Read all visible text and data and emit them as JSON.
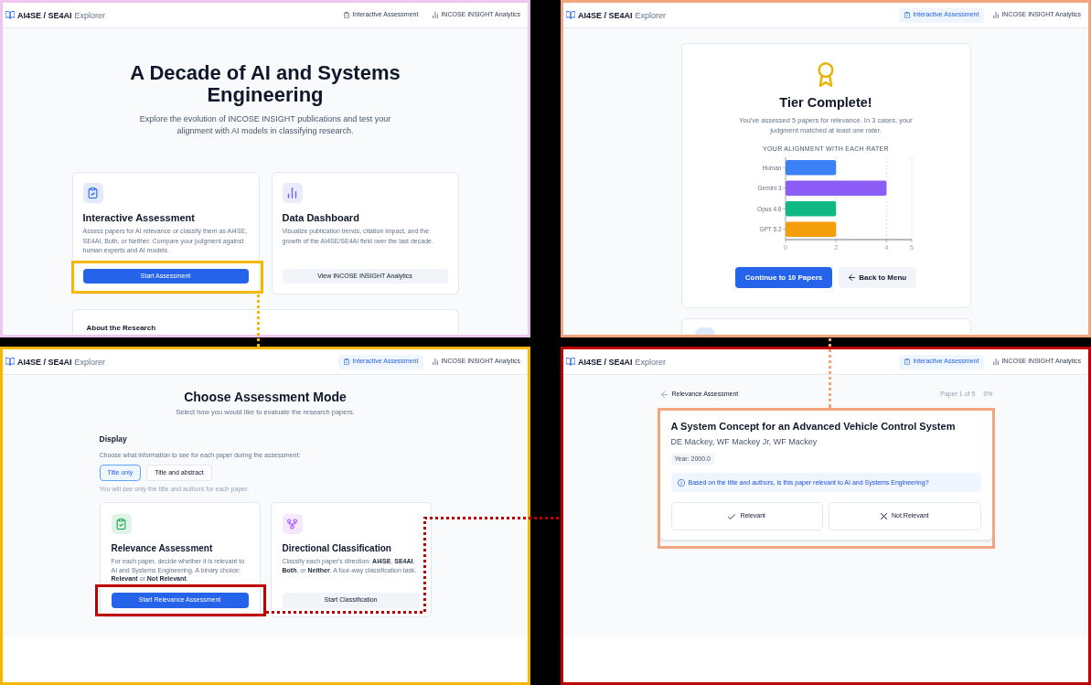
{
  "panels": [
    {
      "kind": "home",
      "color": "#efc6ef",
      "header": {
        "brand": "AI4SE / SE4AI",
        "brand_suffix": "Explorer",
        "nav": [
          {
            "label": "Interactive Assessment",
            "selected": false
          },
          {
            "label": "INCOSE INSIGHT Analytics",
            "selected": false
          }
        ]
      },
      "title": "A Decade of AI and Systems Engineering",
      "subtitle": "Explore the evolution of INCOSE INSIGHT publications and test your alignment with AI models in classifying research.",
      "cards": [
        {
          "title": "Interactive Assessment",
          "color": "#2563eb",
          "description": "Assess papers for AI relevance or classify them as AI4SE, SE4AI, Both, or Neither. Compare your judgment against human experts and AI models.",
          "button": {
            "label": "Start Assessment",
            "kind": "primary",
            "highlight": {
              "color": "#f5b800"
            }
          }
        },
        {
          "title": "Data Dashboard",
          "color": "#6366f1",
          "description": "Visualize publication trends, citation impact, and the growth of the AI4SE/SE4AI field over the last decade.",
          "button": {
            "label": "View INCOSE INSIGHT Analytics",
            "kind": "secondary"
          }
        }
      ],
      "section_title": "About the Research"
    },
    {
      "kind": "results",
      "color": "#f3a67e",
      "header": {
        "brand": "AI4SE / SE4AI",
        "brand_suffix": "Explorer",
        "nav": [
          {
            "label": "Interactive Assessment",
            "selected": true
          },
          {
            "label": "INCOSE INSIGHT Analytics",
            "selected": false
          }
        ]
      },
      "title": "Tier Complete!",
      "message": "You've assessed 5 papers for relevance. In 3 cases, your judgment matched at least one rater.",
      "chart_data": {
        "type": "bar",
        "title": "YOUR ALIGNMENT WITH EACH RATER",
        "orientation": "horizontal",
        "categories": [
          "Human",
          "Gemini 3",
          "Opus 4.6",
          "GPT 5.2"
        ],
        "series": [
          {
            "color": "#3b82f6",
            "values": [
              2,
              null,
              null,
              null
            ]
          },
          {
            "color": "#8b5cf6",
            "values": [
              null,
              4,
              null,
              null
            ]
          },
          {
            "color": "#10b981",
            "values": [
              null,
              null,
              2,
              null
            ]
          },
          {
            "color": "#f59e0b",
            "values": [
              null,
              null,
              null,
              2
            ]
          }
        ],
        "xlim": [
          0,
          5
        ],
        "xticks": [
          0,
          2,
          4,
          5
        ]
      },
      "buttons": [
        {
          "label": "Continue to 10 Papers",
          "kind": "primary"
        },
        {
          "label": "Back to Menu",
          "kind": "secondary"
        }
      ]
    },
    {
      "kind": "mode",
      "color": "#f5b800",
      "header": {
        "brand": "AI4SE / SE4AI",
        "brand_suffix": "Explorer",
        "nav": [
          {
            "label": "Interactive Assessment",
            "selected": true
          },
          {
            "label": "INCOSE INSIGHT Analytics",
            "selected": false
          }
        ]
      },
      "title": "Choose Assessment Mode",
      "subtitle": "Select how you would like to evaluate the research papers.",
      "display": {
        "label": "Display",
        "description": "Choose what information to see for each paper during the assessment:",
        "options": [
          {
            "label": "Title only",
            "selected": true
          },
          {
            "label": "Title and abstract",
            "selected": false
          }
        ],
        "hint": "You will see only the title and authors for each paper."
      },
      "cards": [
        {
          "title": "Relevance Assessment",
          "color": "#16a34a",
          "description": "For each paper, decide whether it is relevant to AI and Systems Engineering. A binary choice: **Relevant** or **Not Relevant**.",
          "button": {
            "label": "Start Relevance Assessment",
            "kind": "primary",
            "highlight": {
              "color": "#c00000"
            }
          }
        },
        {
          "title": "Directional Classification",
          "color": "#a855f7",
          "description": "Classify each paper's direction: **AI4SE**, **SE4AI**, **Both**, or **Neither**. A four-way classification task.",
          "button": {
            "label": "Start Classification",
            "kind": "secondary"
          }
        }
      ]
    },
    {
      "kind": "question",
      "color": "#c00000",
      "header": {
        "brand": "AI4SE / SE4AI",
        "brand_suffix": "Explorer",
        "nav": [
          {
            "label": "Interactive Assessment",
            "selected": true
          },
          {
            "label": "INCOSE INSIGHT Analytics",
            "selected": false
          }
        ]
      },
      "back_label": "Relevance Assessment",
      "progress": "Paper 1 of 5",
      "percent": "0%",
      "paper": {
        "title": "A System Concept for an Advanced Vehicle Control System",
        "authors": "DE Mackey, WF Mackey Jr, WF Mackey",
        "year": "Year: 2000.0",
        "prompt": "Based on the title and authors, is this paper relevant to AI and Systems Engineering?",
        "highlight": {
          "color": "#f3a67e"
        }
      },
      "answers": [
        {
          "label": "Relevant"
        },
        {
          "label": "Not Relevant"
        }
      ]
    }
  ],
  "connectors": [
    {
      "color": "#f5b800"
    },
    {
      "color": "#f3a67e"
    },
    {
      "color": "#c00000"
    }
  ]
}
